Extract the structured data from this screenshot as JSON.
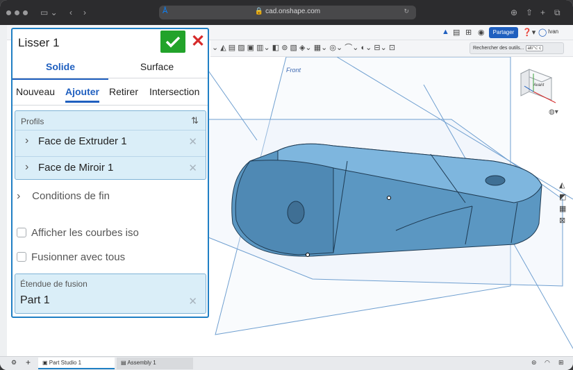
{
  "browser": {
    "url": "cad.onshape.com"
  },
  "app": {
    "share_label": "Partager",
    "user_name": "Ivan",
    "search_tools_label": "Rechercher des outils...",
    "search_shortcut": "alt/⌥ c"
  },
  "viewport": {
    "plane_label": "Front",
    "view_cube_label": "Avant"
  },
  "dialog": {
    "title": "Lisser 1",
    "tabs": [
      "Solide",
      "Surface"
    ],
    "operations": [
      "Nouveau",
      "Ajouter",
      "Retirer",
      "Intersection"
    ],
    "profiles_label": "Profils",
    "profiles": [
      "Face de Extruder 1",
      "Face de Miroir 1"
    ],
    "end_conditions_label": "Conditions de fin",
    "iso_curves_label": "Afficher les courbes iso",
    "merge_all_label": "Fusionner avec tous",
    "merge_scope_label": "Étendue de fusion",
    "merge_scope_value": "Part 1"
  },
  "bottom": {
    "tabs": [
      "Part Studio 1",
      "Assembly 1"
    ]
  },
  "colors": {
    "accent": "#1f5fbf",
    "dialog_border": "#1f7fc4",
    "ok": "#22a32a",
    "cancel": "#d62b2b",
    "part_fill": "#5b97c2"
  },
  "icons": [
    "wifi-icon",
    "lock-icon",
    "reload-icon",
    "download-icon",
    "share-icon",
    "add-tab-icon",
    "tabs-icon",
    "sidebar-icon",
    "back-icon",
    "forward-icon",
    "check-icon",
    "close-icon",
    "sort-icon",
    "chevron-right-icon",
    "add-icon",
    "help-icon",
    "user-icon",
    "notification-icon"
  ]
}
